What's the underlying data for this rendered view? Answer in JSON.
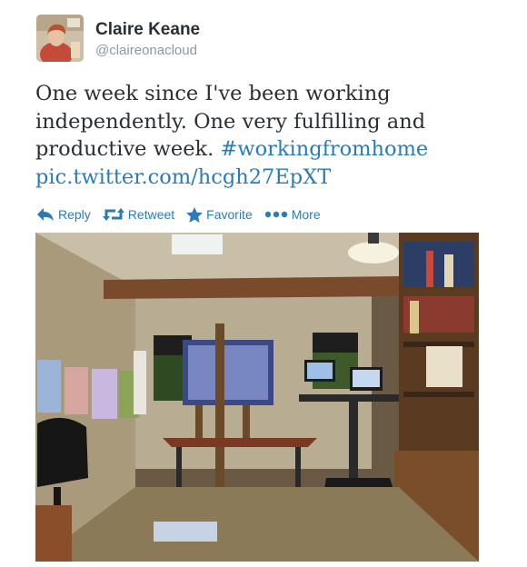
{
  "user": {
    "name": "Claire Keane",
    "handle": "@claireonacloud"
  },
  "tweet": {
    "text": "One week since I've been working independently. One very fulfilling and productive week.",
    "hashtag": "#workingfromhome",
    "link": "pic.twitter.com/hcgh27EpXT"
  },
  "actions": {
    "reply": "Reply",
    "retweet": "Retweet",
    "favorite": "Favorite",
    "more": "More"
  },
  "icons": {
    "reply": "reply-arrow-icon",
    "retweet": "retweet-icon",
    "favorite": "star-icon",
    "more": "more-dots-icon"
  },
  "colors": {
    "link": "#2b7bb9",
    "text": "#292f33",
    "muted": "#8899a6"
  }
}
